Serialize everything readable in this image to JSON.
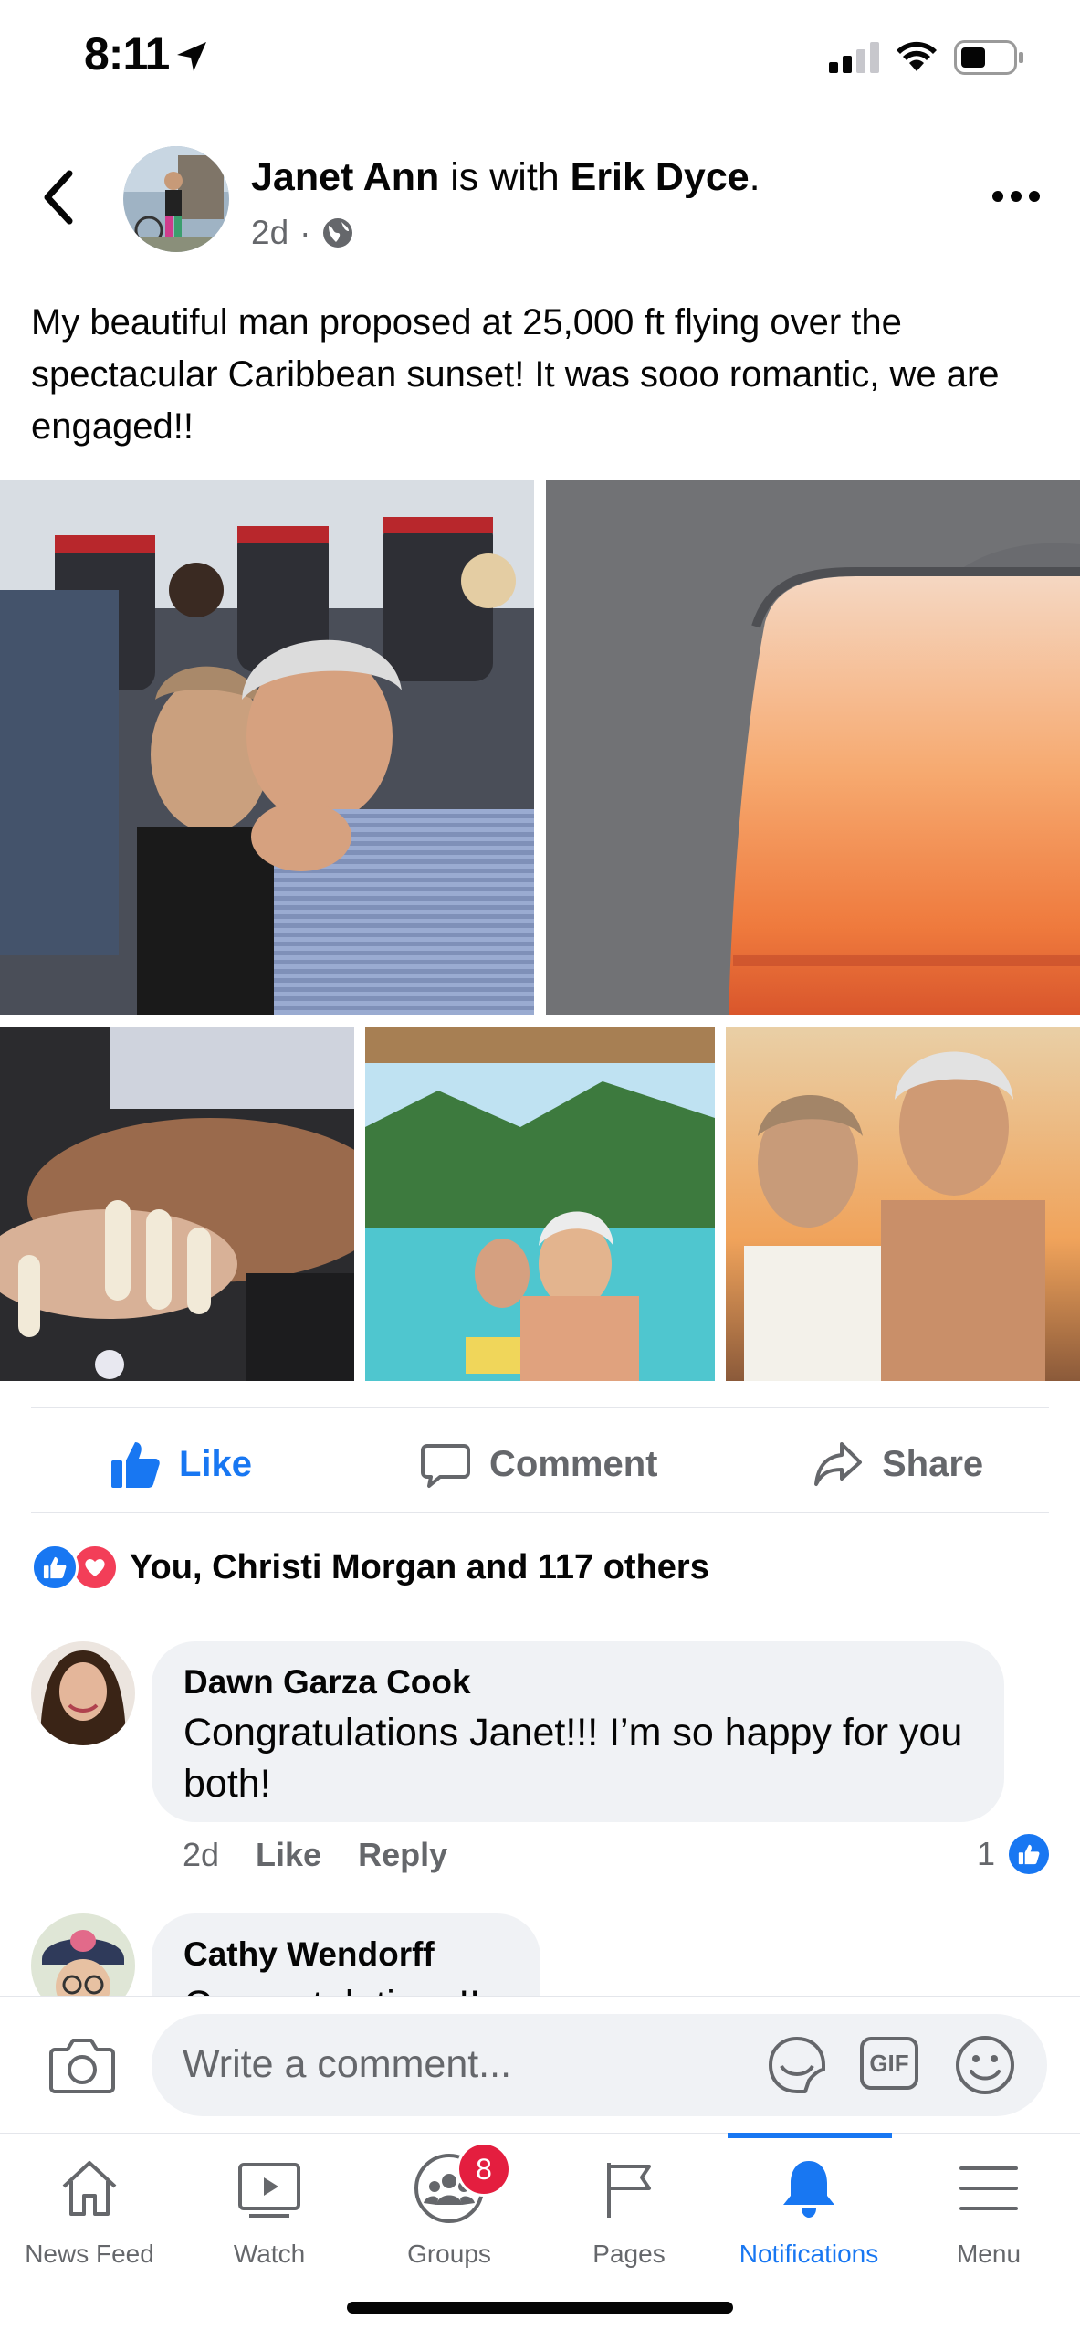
{
  "status": {
    "time": "8:11"
  },
  "post": {
    "author": "Janet Ann",
    "with_text": " is with ",
    "tagged": "Erik Dyce",
    "period": ".",
    "time": "2d",
    "dot": "·",
    "text": "My beautiful man proposed at 25,000 ft flying over the spectacular Caribbean sunset! It was sooo romantic, we are engaged!!"
  },
  "actions": {
    "like": "Like",
    "comment": "Comment",
    "share": "Share"
  },
  "reactions": {
    "summary": "You, Christi Morgan and 117 others"
  },
  "comments": [
    {
      "name": "Dawn Garza Cook",
      "text": "Congratulations Janet!!!   I’m so happy for you both!",
      "time": "2d",
      "like": "Like",
      "reply": "Reply",
      "likes": "1"
    },
    {
      "name": "Cathy Wendorff",
      "text": "Congratulations!!"
    }
  ],
  "composer": {
    "placeholder": "Write a comment...",
    "gif": "GIF"
  },
  "tabs": [
    {
      "label": "News Feed"
    },
    {
      "label": "Watch"
    },
    {
      "label": "Groups",
      "badge": "8"
    },
    {
      "label": "Pages"
    },
    {
      "label": "Notifications"
    },
    {
      "label": "Menu"
    }
  ],
  "colors": {
    "accent": "#1877f2",
    "badge": "#e41e3f",
    "bubble": "#f0f2f5"
  }
}
